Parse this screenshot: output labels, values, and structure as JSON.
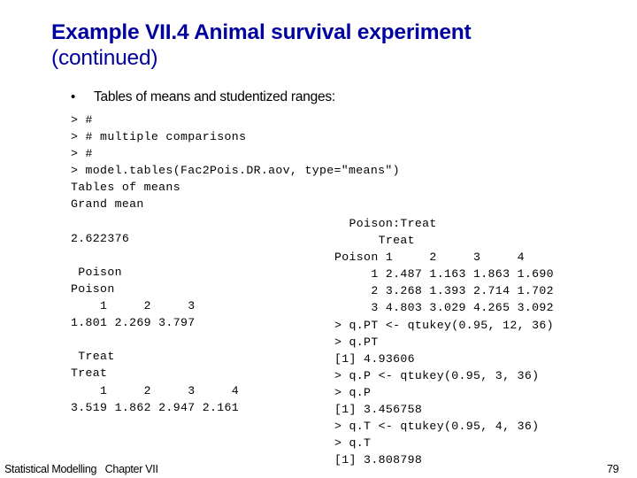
{
  "slide": {
    "title_main": "Example VII.4 Animal survival experiment",
    "title_sub": "(continued)",
    "title_color": "#0000a0",
    "background_color": "#ffffff",
    "bullet_marker": "•",
    "bullet_text": "Tables of means and studentized ranges:"
  },
  "console_left": {
    "lines": [
      "> #",
      "> # multiple comparisons",
      "> #",
      "> model.tables(Fac2Pois.DR.aov, type=\"means\")",
      "Tables of means",
      "Grand mean",
      "",
      "2.622376",
      "",
      " Poison",
      "Poison",
      "    1     2     3",
      "1.801 2.269 3.797",
      "",
      " Treat",
      "Treat",
      "    1     2     3     4",
      "3.519 1.862 2.947 2.161"
    ]
  },
  "console_right": {
    "lines": [
      "  Poison:Treat",
      "      Treat",
      "Poison 1     2     3     4",
      "     1 2.487 1.163 1.863 1.690",
      "     2 3.268 1.393 2.714 1.702",
      "     3 4.803 3.029 4.265 3.092",
      "> q.PT <- qtukey(0.95, 12, 36)",
      "> q.PT",
      "[1] 4.93606",
      "> q.P <- qtukey(0.95, 3, 36)",
      "> q.P",
      "[1] 3.456758",
      "> q.T <- qtukey(0.95, 4, 36)",
      "> q.T",
      "[1] 3.808798"
    ]
  },
  "tables": {
    "grand_mean": 2.622376,
    "poison_main": {
      "factor": "Poison",
      "levels": [
        "1",
        "2",
        "3"
      ],
      "means": [
        1.801,
        2.269,
        3.797
      ]
    },
    "treat_main": {
      "factor": "Treat",
      "levels": [
        "1",
        "2",
        "3",
        "4"
      ],
      "means": [
        3.519,
        1.862,
        2.947,
        2.161
      ]
    },
    "poison_treat": {
      "row_factor": "Poison",
      "col_factor": "Treat",
      "row_levels": [
        "1",
        "2",
        "3"
      ],
      "col_levels": [
        "1",
        "2",
        "3",
        "4"
      ],
      "means": [
        [
          2.487,
          1.163,
          1.863,
          1.69
        ],
        [
          3.268,
          1.393,
          2.714,
          1.702
        ],
        [
          4.803,
          3.029,
          4.265,
          3.092
        ]
      ]
    },
    "studentized_ranges": [
      {
        "name": "q.PT",
        "call": "qtukey(0.95, 12, 36)",
        "value": 4.93606
      },
      {
        "name": "q.P",
        "call": "qtukey(0.95, 3, 36)",
        "value": 3.456758
      },
      {
        "name": "q.T",
        "call": "qtukey(0.95, 4, 36)",
        "value": 3.808798
      }
    ]
  },
  "footer": {
    "left": "Statistical Modelling   Chapter VII",
    "page_number": "79"
  }
}
